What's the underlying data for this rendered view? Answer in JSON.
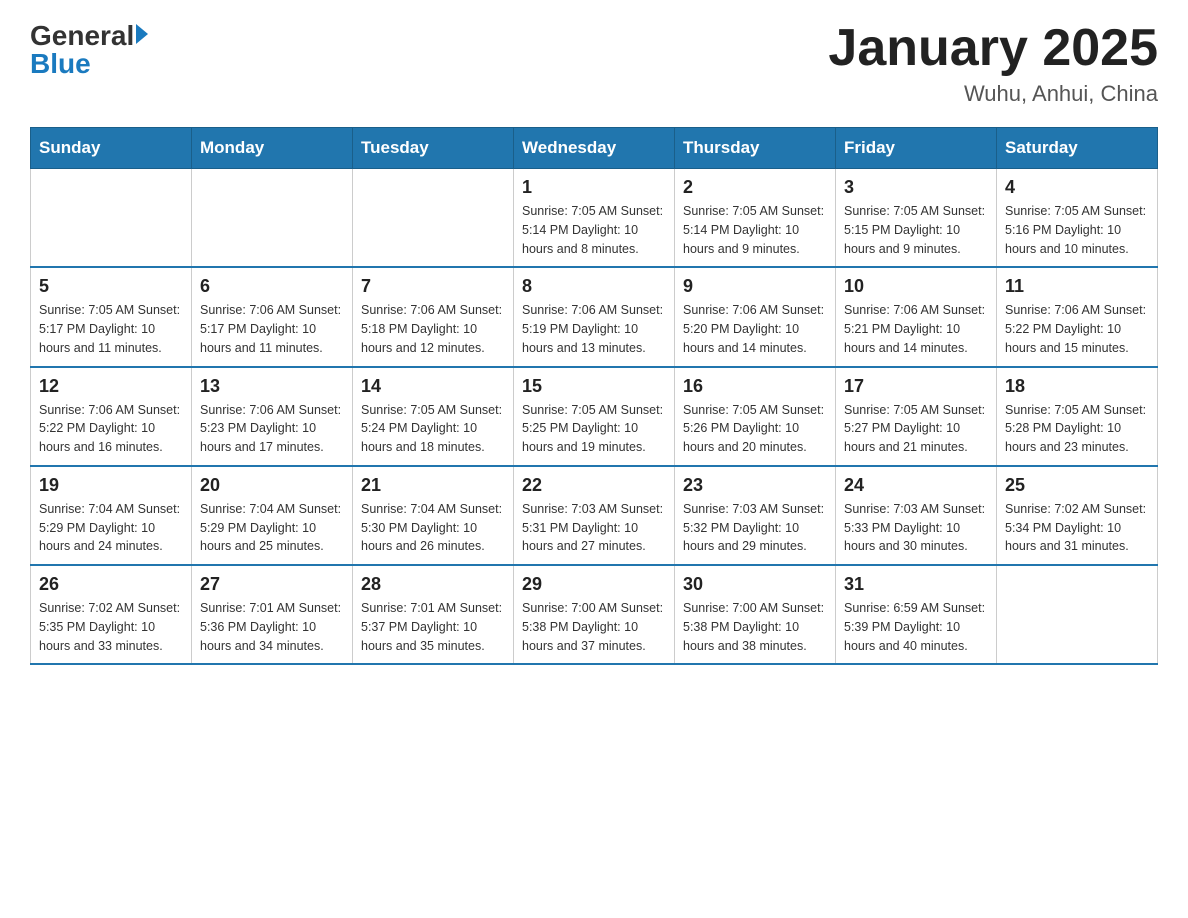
{
  "header": {
    "logo_general": "General",
    "logo_blue": "Blue",
    "title": "January 2025",
    "subtitle": "Wuhu, Anhui, China"
  },
  "days_of_week": [
    "Sunday",
    "Monday",
    "Tuesday",
    "Wednesday",
    "Thursday",
    "Friday",
    "Saturday"
  ],
  "weeks": [
    [
      {
        "day": "",
        "info": ""
      },
      {
        "day": "",
        "info": ""
      },
      {
        "day": "",
        "info": ""
      },
      {
        "day": "1",
        "info": "Sunrise: 7:05 AM\nSunset: 5:14 PM\nDaylight: 10 hours\nand 8 minutes."
      },
      {
        "day": "2",
        "info": "Sunrise: 7:05 AM\nSunset: 5:14 PM\nDaylight: 10 hours\nand 9 minutes."
      },
      {
        "day": "3",
        "info": "Sunrise: 7:05 AM\nSunset: 5:15 PM\nDaylight: 10 hours\nand 9 minutes."
      },
      {
        "day": "4",
        "info": "Sunrise: 7:05 AM\nSunset: 5:16 PM\nDaylight: 10 hours\nand 10 minutes."
      }
    ],
    [
      {
        "day": "5",
        "info": "Sunrise: 7:05 AM\nSunset: 5:17 PM\nDaylight: 10 hours\nand 11 minutes."
      },
      {
        "day": "6",
        "info": "Sunrise: 7:06 AM\nSunset: 5:17 PM\nDaylight: 10 hours\nand 11 minutes."
      },
      {
        "day": "7",
        "info": "Sunrise: 7:06 AM\nSunset: 5:18 PM\nDaylight: 10 hours\nand 12 minutes."
      },
      {
        "day": "8",
        "info": "Sunrise: 7:06 AM\nSunset: 5:19 PM\nDaylight: 10 hours\nand 13 minutes."
      },
      {
        "day": "9",
        "info": "Sunrise: 7:06 AM\nSunset: 5:20 PM\nDaylight: 10 hours\nand 14 minutes."
      },
      {
        "day": "10",
        "info": "Sunrise: 7:06 AM\nSunset: 5:21 PM\nDaylight: 10 hours\nand 14 minutes."
      },
      {
        "day": "11",
        "info": "Sunrise: 7:06 AM\nSunset: 5:22 PM\nDaylight: 10 hours\nand 15 minutes."
      }
    ],
    [
      {
        "day": "12",
        "info": "Sunrise: 7:06 AM\nSunset: 5:22 PM\nDaylight: 10 hours\nand 16 minutes."
      },
      {
        "day": "13",
        "info": "Sunrise: 7:06 AM\nSunset: 5:23 PM\nDaylight: 10 hours\nand 17 minutes."
      },
      {
        "day": "14",
        "info": "Sunrise: 7:05 AM\nSunset: 5:24 PM\nDaylight: 10 hours\nand 18 minutes."
      },
      {
        "day": "15",
        "info": "Sunrise: 7:05 AM\nSunset: 5:25 PM\nDaylight: 10 hours\nand 19 minutes."
      },
      {
        "day": "16",
        "info": "Sunrise: 7:05 AM\nSunset: 5:26 PM\nDaylight: 10 hours\nand 20 minutes."
      },
      {
        "day": "17",
        "info": "Sunrise: 7:05 AM\nSunset: 5:27 PM\nDaylight: 10 hours\nand 21 minutes."
      },
      {
        "day": "18",
        "info": "Sunrise: 7:05 AM\nSunset: 5:28 PM\nDaylight: 10 hours\nand 23 minutes."
      }
    ],
    [
      {
        "day": "19",
        "info": "Sunrise: 7:04 AM\nSunset: 5:29 PM\nDaylight: 10 hours\nand 24 minutes."
      },
      {
        "day": "20",
        "info": "Sunrise: 7:04 AM\nSunset: 5:29 PM\nDaylight: 10 hours\nand 25 minutes."
      },
      {
        "day": "21",
        "info": "Sunrise: 7:04 AM\nSunset: 5:30 PM\nDaylight: 10 hours\nand 26 minutes."
      },
      {
        "day": "22",
        "info": "Sunrise: 7:03 AM\nSunset: 5:31 PM\nDaylight: 10 hours\nand 27 minutes."
      },
      {
        "day": "23",
        "info": "Sunrise: 7:03 AM\nSunset: 5:32 PM\nDaylight: 10 hours\nand 29 minutes."
      },
      {
        "day": "24",
        "info": "Sunrise: 7:03 AM\nSunset: 5:33 PM\nDaylight: 10 hours\nand 30 minutes."
      },
      {
        "day": "25",
        "info": "Sunrise: 7:02 AM\nSunset: 5:34 PM\nDaylight: 10 hours\nand 31 minutes."
      }
    ],
    [
      {
        "day": "26",
        "info": "Sunrise: 7:02 AM\nSunset: 5:35 PM\nDaylight: 10 hours\nand 33 minutes."
      },
      {
        "day": "27",
        "info": "Sunrise: 7:01 AM\nSunset: 5:36 PM\nDaylight: 10 hours\nand 34 minutes."
      },
      {
        "day": "28",
        "info": "Sunrise: 7:01 AM\nSunset: 5:37 PM\nDaylight: 10 hours\nand 35 minutes."
      },
      {
        "day": "29",
        "info": "Sunrise: 7:00 AM\nSunset: 5:38 PM\nDaylight: 10 hours\nand 37 minutes."
      },
      {
        "day": "30",
        "info": "Sunrise: 7:00 AM\nSunset: 5:38 PM\nDaylight: 10 hours\nand 38 minutes."
      },
      {
        "day": "31",
        "info": "Sunrise: 6:59 AM\nSunset: 5:39 PM\nDaylight: 10 hours\nand 40 minutes."
      },
      {
        "day": "",
        "info": ""
      }
    ]
  ]
}
